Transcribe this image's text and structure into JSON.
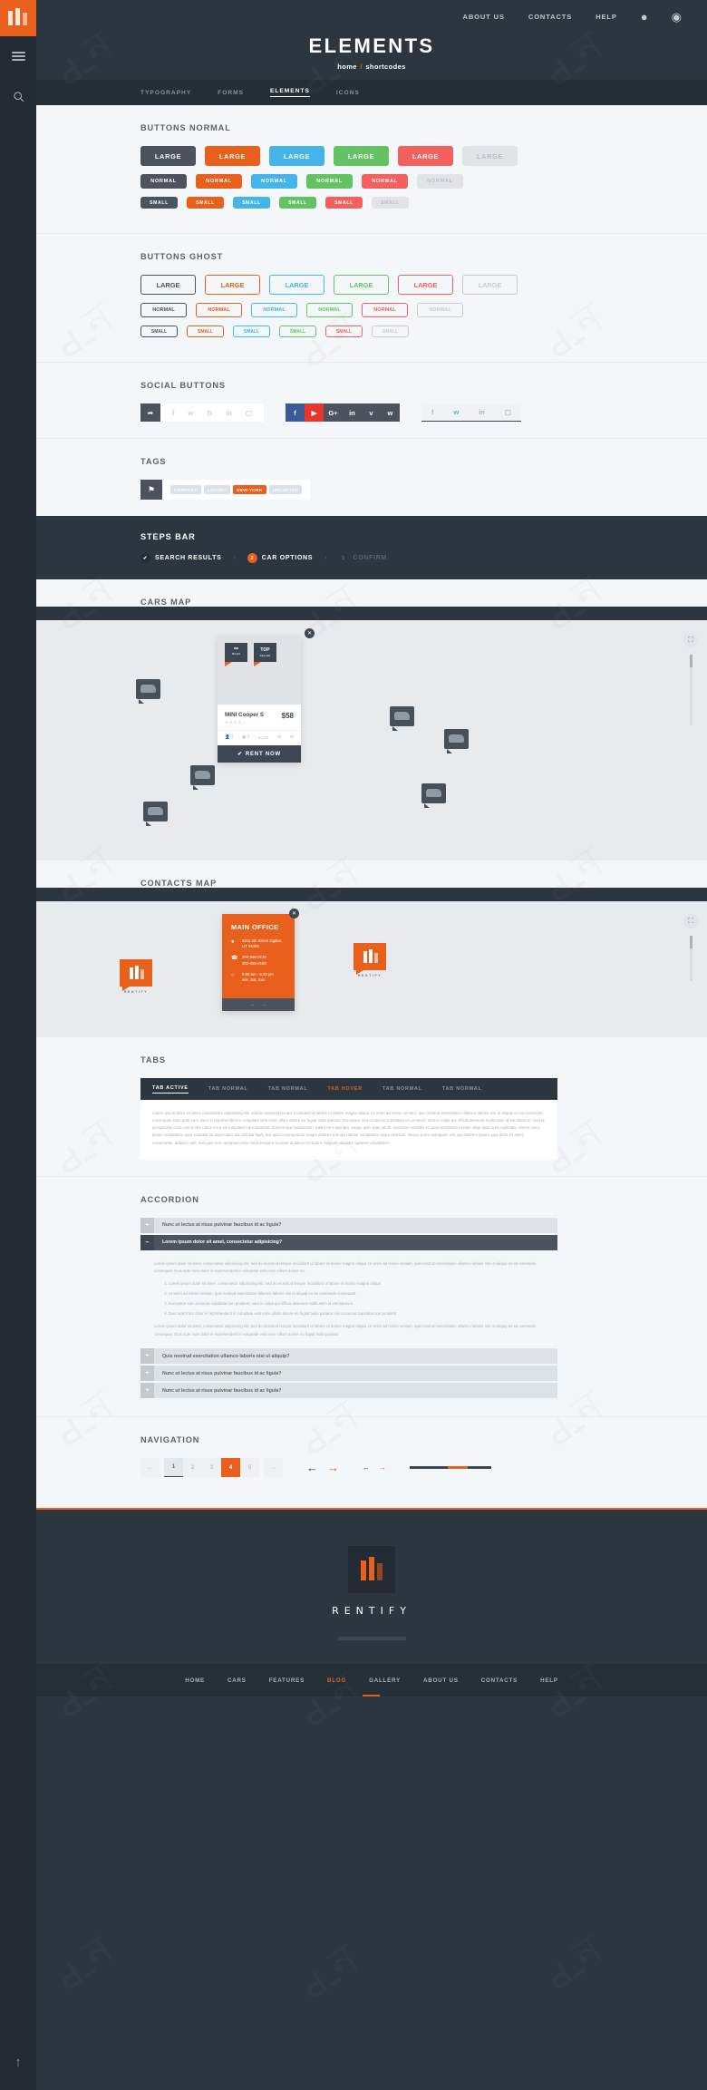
{
  "brand": {
    "name": "RENTIFY",
    "accent": "#e8601c",
    "dark": "#2c3640"
  },
  "topnav": {
    "items": [
      "ABOUT US",
      "CONTACTS",
      "HELP"
    ],
    "icons": [
      "user-icon",
      "globe-icon"
    ]
  },
  "hero": {
    "title": "ELEMENTS",
    "crumb_home": "home",
    "crumb_sep": "/",
    "crumb_current": "shortcodes"
  },
  "page_tabs": {
    "items": [
      "TYPOGRAPHY",
      "FORMS",
      "ELEMENTS",
      "ICONS"
    ],
    "active": "ELEMENTS"
  },
  "sections": {
    "buttons_normal": {
      "title": "BUTTONS NORMAL",
      "rows": [
        {
          "size": "lg",
          "labels": [
            "LARGE",
            "LARGE",
            "LARGE",
            "LARGE",
            "LARGE",
            "LARGE"
          ]
        },
        {
          "size": "nm",
          "labels": [
            "NORMAL",
            "NORMAL",
            "NORMAL",
            "NORMAL",
            "NORMAL",
            "NORMAL"
          ]
        },
        {
          "size": "sm",
          "labels": [
            "SMALL",
            "SMALL",
            "SMALL",
            "SMALL",
            "SMALL",
            "SMALL"
          ]
        }
      ],
      "colors": [
        "#4b545e",
        "#e8601c",
        "#45b4ea",
        "#63c363",
        "#f4615c",
        "#e0e4e7"
      ]
    },
    "buttons_ghost": {
      "title": "BUTTONS GHOST",
      "rows": [
        {
          "size": "lg",
          "labels": [
            "LARGE",
            "LARGE",
            "LARGE",
            "LARGE",
            "LARGE",
            "LARGE"
          ]
        },
        {
          "size": "nm",
          "labels": [
            "NORMAL",
            "NORMAL",
            "NORMAL",
            "NORMAL",
            "NORMAL",
            "NORMAL"
          ]
        },
        {
          "size": "sm",
          "labels": [
            "SMALL",
            "SMALL",
            "SMALL",
            "SMALL",
            "SMALL",
            "SMALL"
          ]
        }
      ]
    },
    "social": {
      "title": "SOCIAL BUTTONS",
      "group1": {
        "lead": "share-icon",
        "icons": [
          "f",
          "t",
          "G",
          "in",
          "ig"
        ]
      },
      "group2": {
        "icons": [
          "f",
          "yt",
          "G+",
          "in",
          "v",
          "t"
        ],
        "colors": [
          "#3b5998",
          "#e8352d",
          "#4b545e",
          "#4b545e",
          "#4b545e",
          "#4b545e"
        ]
      },
      "group3": {
        "icons": [
          "f",
          "t",
          "in",
          "ig"
        ],
        "highlight": "t"
      }
    },
    "tags": {
      "title": "TAGS",
      "lead": "tag-icon",
      "items": [
        "COMPACT",
        "LUXORY",
        "NEW-YORK",
        "UNLIMITED"
      ],
      "active": "NEW-YORK"
    },
    "steps": {
      "title": "STEPS BAR",
      "items": [
        {
          "label": "SEARCH RESULTS",
          "mark": "✔",
          "state": "done"
        },
        {
          "label": "CAR OPTIONS",
          "mark": "2",
          "state": "act"
        },
        {
          "label": "CONFIRM",
          "mark": "3",
          "state": "off"
        }
      ],
      "separator": "›"
    },
    "cars_map": {
      "title": "CARS MAP",
      "card": {
        "badge1_top": "∞",
        "badge1_sub": "MILES",
        "badge2_top": "TOP",
        "badge2_sub": "SELLER",
        "name": "MINI Cooper S",
        "price": "$58",
        "stars": "★★★★☆",
        "specs": [
          "4",
          "3",
          "121",
          "",
          ""
        ],
        "rent_label": "RENT NOW",
        "close": "✕"
      }
    },
    "contacts_map": {
      "title": "CONTACTS MAP",
      "card": {
        "heading": "MAIN OFFICE",
        "address": "9211 4th Street Ogden, UT 84404",
        "phones": "202-555-0139\n202-555-0188",
        "hours": "9.00 am - 6.00 pm\nw/e: Sat, Sun",
        "close": "✕"
      },
      "logo_caption": "RENTIFY"
    },
    "tabs": {
      "title": "TABS",
      "items": [
        "TAB ACTIVE",
        "TAB NORMAL",
        "TAB NORMAL",
        "TAB HOVER",
        "TAB NORMAL",
        "TAB NORMAL"
      ],
      "active": "TAB ACTIVE",
      "hover": "TAB HOVER",
      "body": "Lorem ipsum dolor sit amet, consectetur adipisicing elit, sed do eiusmod tempor incididunt ut labore et dolore magna aliqua. Ut enim ad minim veniam, quis nostrud exercitation ullamco laboris nisi ut aliquip ex ea commodo consequat. Duis aute irure dolor in reprehenderit in voluptate velit esse cillum dolore eu fugiat nulla pariatur. Excepteur sint occaecat cupidatat non proident, sunt in culpa qui officia deserunt mollit anim id est laborum. Sed ut perspiciatis unde omnis iste natus error sit voluptatem accusantium doloremque laudantium, totam rem aperiam, eaque ipsa quae ab illo inventore veritatis et quasi architecto beatae vitae dicta sunt explicabo. Nemo enim ipsam voluptatem quia voluptas sit aspernatur aut odit aut fugit, sed quia consequuntur magni dolores eos qui ratione voluptatem sequi nesciunt. Neque porro quisquam est, qui dolorem ipsum quia dolor sit amet, consectetur, adipisci velit, sed quia non numquam eius modi tempora incidunt ut labore et dolore magnam aliquam quaerat voluptatem."
    },
    "accordion": {
      "title": "ACCORDION",
      "items": [
        {
          "label": "Nunc ut lectus at risus pulvinar faucibus id ac ligula?",
          "state": "closed",
          "sign": "+"
        },
        {
          "label": "Lorem ipsum dolor sit amet, consectetur adipisicing?",
          "state": "open",
          "sign": "–"
        },
        {
          "label": "Quis nostrud exercitation ullamco laboris nisi ut aliquip?",
          "state": "closed",
          "sign": "+"
        },
        {
          "label": "Nunc ut lectus at risus pulvinar faucibus id ac ligula?",
          "state": "closed",
          "sign": "+"
        },
        {
          "label": "Nunc ut lectus at risus pulvinar faucibus id ac ligula?",
          "state": "closed",
          "sign": "+"
        }
      ],
      "body_p1": "Lorem ipsum dolor sit amet, consectetur adipisicing elit, sed do eiusmod tempor incididunt ut labore et dolore magna aliqua. Ut enim ad minim veniam, quis nostrud exercitation ullamco laboris nisi ut aliquip ex ea commodo consequat. Duis aute irure dolor in reprehenderit in voluptate velit esse cillum dolore eu.",
      "list": [
        "Lorem ipsum dolor sit amet, consectetur adipisicing elit, sed do eiusmod tempor incididunt ut labore et dolore magna aliqua.",
        "Ut enim ad minim veniam, quis nostrud exercitation ullamco laboris nisi ut aliquip ex ea commodo consequat.",
        "Excepteur sint occaecat cupidatat non proident, sunt in culpa qui officia deserunt mollit anim id est laborum.",
        "Duis aute irure dolor in reprehenderit in voluptate velit esse cillum dolore eu fugiat nulla pariatur nisi occaecat cupidatat non proident."
      ],
      "body_p2": "Lorem ipsum dolor sit amet, consectetur adipisicing elit, sed do eiusmod tempor incididunt ut labore et dolore magna aliqua. Ut enim ad minim veniam, quis nostrud exercitation ullamco laboris nisi ut aliquip ex ea commodo consequat. Duis aute irure dolor in reprehenderit in voluptate velit esse cillum dolore eu fugiat nulla pariatur."
    },
    "navigation": {
      "title": "NAVIGATION",
      "pager": {
        "prev": "←",
        "next": "→",
        "pages": [
          "1",
          "2",
          "3",
          "4",
          "5"
        ],
        "active": "4"
      },
      "arrows_big": {
        "back": "←",
        "fwd": "→"
      },
      "arrows_small": {
        "back": "←",
        "fwd": "→"
      }
    }
  },
  "footer": {
    "name": "RENTIFY",
    "nav": [
      "HOME",
      "CARS",
      "FEATURES",
      "BLOG",
      "GALLERY",
      "ABOUT US",
      "CONTACTS",
      "HELP"
    ],
    "active": "BLOG"
  }
}
